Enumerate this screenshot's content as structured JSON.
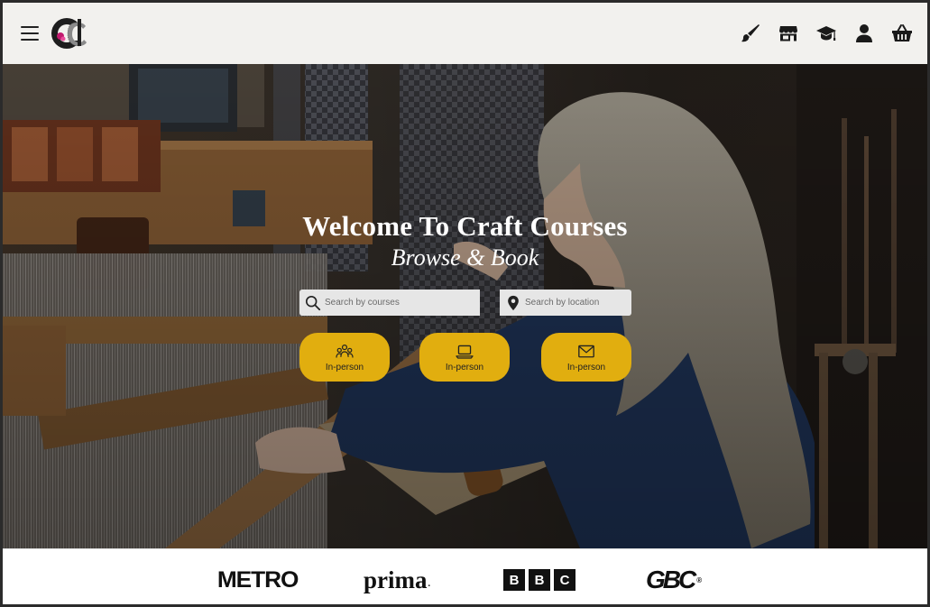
{
  "header": {
    "menu_icon": "hamburger-icon",
    "logo_icon": "craft-courses-logo",
    "nav": [
      {
        "icon": "paintbrush-icon"
      },
      {
        "icon": "storefront-icon"
      },
      {
        "icon": "graduation-cap-icon"
      },
      {
        "icon": "user-icon"
      },
      {
        "icon": "basket-icon"
      }
    ]
  },
  "hero": {
    "title": "Welcome To Craft Courses",
    "subtitle": "Browse & Book",
    "search_courses": {
      "placeholder": "Search by courses",
      "icon": "search-icon"
    },
    "search_location": {
      "placeholder": "Search by location",
      "icon": "location-pin-icon"
    },
    "buttons": [
      {
        "label": "In-person",
        "icon": "people-icon"
      },
      {
        "label": "In-person",
        "icon": "laptop-icon"
      },
      {
        "label": "In-person",
        "icon": "envelope-icon"
      }
    ],
    "button_color": "#e1ae0f"
  },
  "partners": {
    "metro": "METRO",
    "prima": "prima",
    "bbc": [
      "B",
      "B",
      "C"
    ],
    "gbc": "GBC"
  }
}
